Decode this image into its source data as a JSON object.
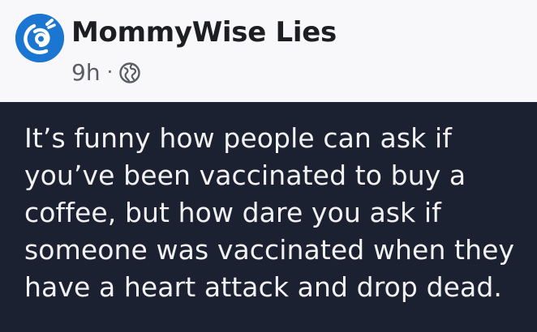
{
  "post": {
    "author": "MommyWise Lies",
    "time_ago": "9h",
    "separator": "·",
    "audience_icon": "globe-icon",
    "avatar_icon": "mother-baby-logo",
    "text": "It’s funny how people can ask if you’ve been vaccinated to buy a coffee, but how dare you ask if someone was vaccinated when they have a heart attack and drop dead."
  },
  "colors": {
    "header_background": "#f8f8fa",
    "post_background": "#1c2132",
    "avatar_blue": "#1b76d2",
    "name_text": "#1c1e21",
    "meta_text": "#5a5d63",
    "post_text": "#f2f2f2"
  }
}
